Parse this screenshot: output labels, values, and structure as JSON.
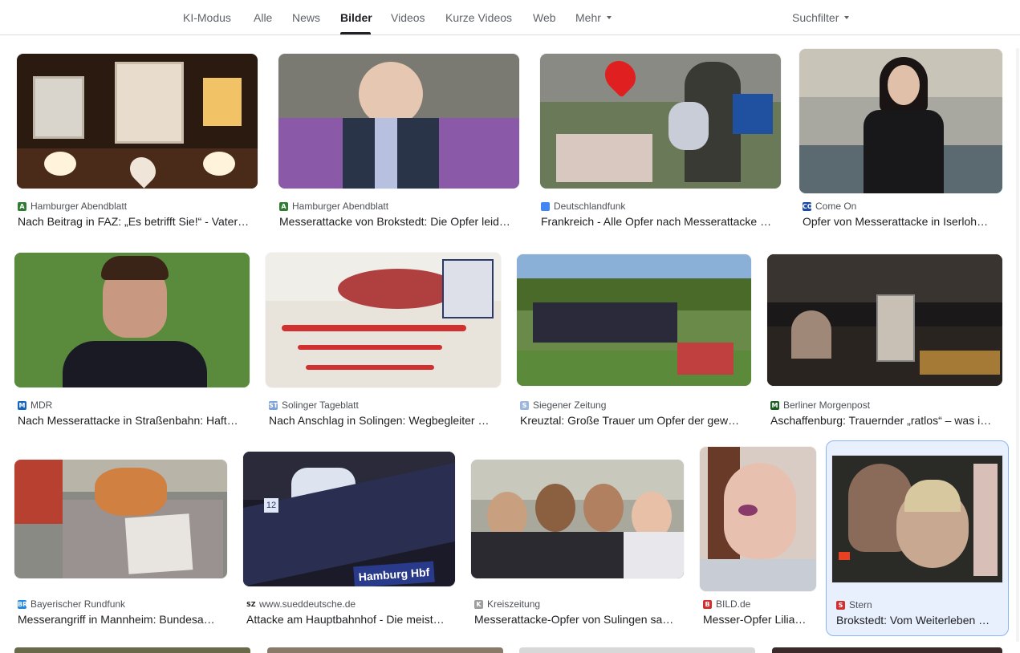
{
  "tabs": {
    "ki": "KI-Modus",
    "alle": "Alle",
    "news": "News",
    "bilder": "Bilder",
    "videos": "Videos",
    "kurze": "Kurze Videos",
    "web": "Web",
    "mehr": "Mehr",
    "suchfilter": "Suchfilter"
  },
  "results": [
    {
      "source": "Hamburger Abendblatt",
      "title": "Nach Beitrag in FAZ: „Es betrifft Sie!“ - Vater…",
      "favicon": "A",
      "favicon_color": "#2e7d32"
    },
    {
      "source": "Hamburger Abendblatt",
      "title": "Messerattacke von Brokstedt: Die Opfer leid…",
      "favicon": "A",
      "favicon_color": "#2e7d32"
    },
    {
      "source": "Deutschlandfunk",
      "title": "Frankreich - Alle Opfer nach Messerattacke …",
      "favicon": "",
      "favicon_color": "#4285f4"
    },
    {
      "source": "Come On",
      "title": "Opfer von Messerattacke in Iserloh…",
      "favicon": "CO",
      "favicon_color": "#1a4aa8"
    },
    {
      "source": "MDR",
      "title": "Nach Messerattacke in Straßenbahn: Haft…",
      "favicon": "M",
      "favicon_color": "#1565c0"
    },
    {
      "source": "Solinger Tageblatt",
      "title": "Nach Anschlag in Solingen: Wegbegleiter …",
      "favicon": "ST",
      "favicon_color": "#7ea3d8"
    },
    {
      "source": "Siegener Zeitung",
      "title": "Kreuztal: Große Trauer um Opfer der gew…",
      "favicon": "S",
      "favicon_color": "#9bb7e0"
    },
    {
      "source": "Berliner Morgenpost",
      "title": "Aschaffenburg: Trauernder „ratlos“ – was i…",
      "favicon": "M",
      "favicon_color": "#1b5e20"
    },
    {
      "source": "Bayerischer Rundfunk",
      "title": "Messerangriff in Mannheim: Bundesa…",
      "favicon": "BR",
      "favicon_color": "#1e88e5"
    },
    {
      "source": "www.sueddeutsche.de",
      "title": "Attacke am Hauptbahnhof - Die meist…",
      "favicon": "SZ",
      "favicon_color": "#202124"
    },
    {
      "source": "Kreiszeitung",
      "title": "Messerattacke-Opfer von Sulingen sa…",
      "favicon": "K",
      "favicon_color": "#9e9e9e"
    },
    {
      "source": "BILD.de",
      "title": "Messer-Opfer Lilia…",
      "favicon": "B",
      "favicon_color": "#d32f2f"
    },
    {
      "source": "Stern",
      "title": "Brokstedt: Vom Weiterleben …",
      "favicon": "S",
      "favicon_color": "#d32f2f"
    }
  ],
  "image_texts": {
    "station_sign": "Hamburg Hbf",
    "platform_number": "12"
  },
  "colors": {
    "tab_active": "#202124",
    "tab_inactive": "#5f6368",
    "selected_bg": "#e8f0fe",
    "selected_border": "#8ab4f8"
  }
}
